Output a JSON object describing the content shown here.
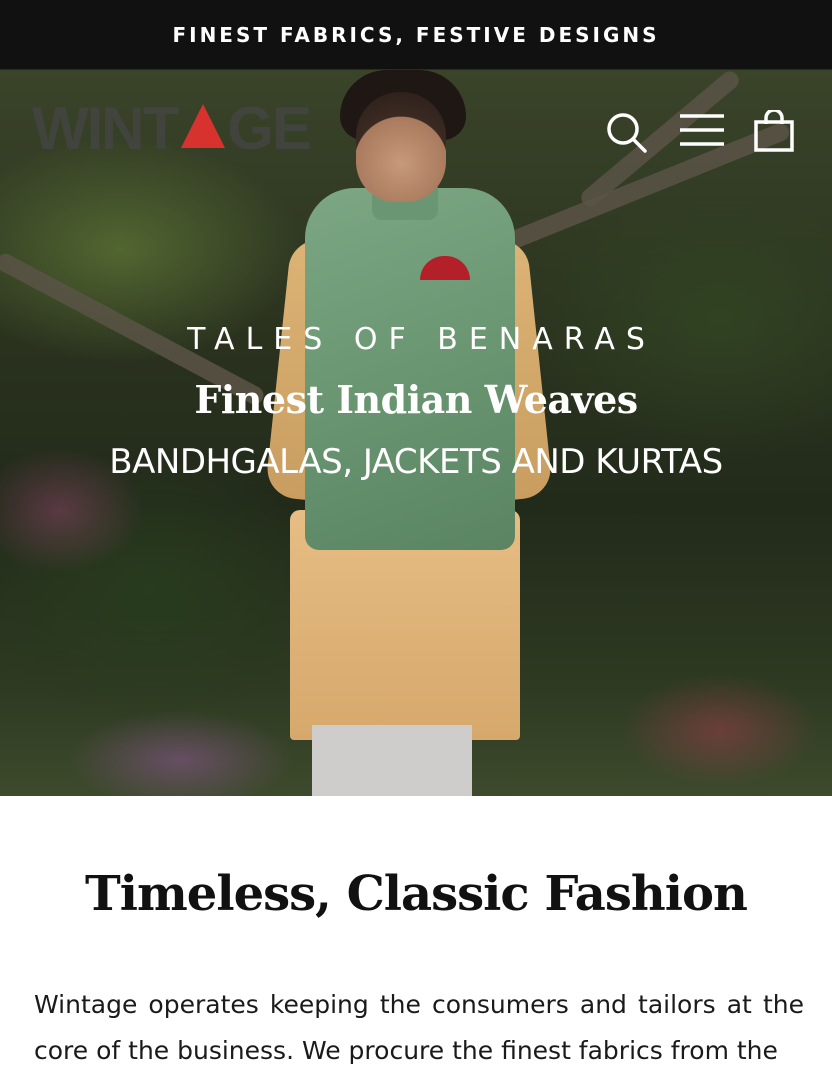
{
  "announcement": {
    "text": "FINEST FABRICS, FESTIVE DESIGNS"
  },
  "header": {
    "logo_text": "WINTAGE",
    "icons": [
      "search-icon",
      "menu-icon",
      "cart-icon"
    ]
  },
  "hero": {
    "eyebrow": "TALES OF BENARAS",
    "headline": "Finest Indian Weaves",
    "subline": "BANDHGALAS, JACKETS AND KURTAS"
  },
  "intro": {
    "title": "Timeless, Classic Fashion",
    "body": "Wintage operates keeping the consumers and tailors at the core of the business. We procure the finest fabrics from the"
  },
  "colors": {
    "announce_bg": "#111111",
    "logo_accent": "#d8322f",
    "text_dark": "#111111"
  }
}
